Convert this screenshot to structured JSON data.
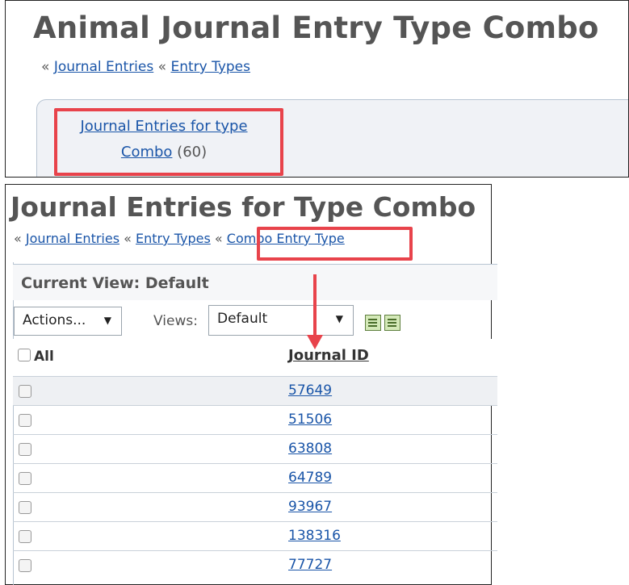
{
  "top": {
    "title": "Animal Journal Entry Type Combo",
    "crumb_sep": "«",
    "crumb1": "Journal Entries",
    "crumb2": "Entry Types",
    "link_line1": "Journal Entries for type",
    "link_line2": "Combo",
    "link_count": "(60)"
  },
  "bottom": {
    "title": "Journal Entries for Type Combo",
    "crumb_sep": "«",
    "crumb1": "Journal Entries",
    "crumb2": "Entry Types",
    "crumb3": "Combo Entry Type",
    "current_view": "Current View: Default",
    "actions_label": "Actions...",
    "views_label": "Views:",
    "views_value": "Default",
    "all_label": "All",
    "col_header": "Journal ID",
    "rows": [
      "57649",
      "51506",
      "63808",
      "64789",
      "93967",
      "138316",
      "77727"
    ]
  },
  "icons": {
    "caret": "▼",
    "grid_icon_1": "add-grid-icon",
    "grid_icon_2": "refresh-grid-icon"
  },
  "colors": {
    "highlight": "#e8434b",
    "link": "#1a55a8"
  }
}
